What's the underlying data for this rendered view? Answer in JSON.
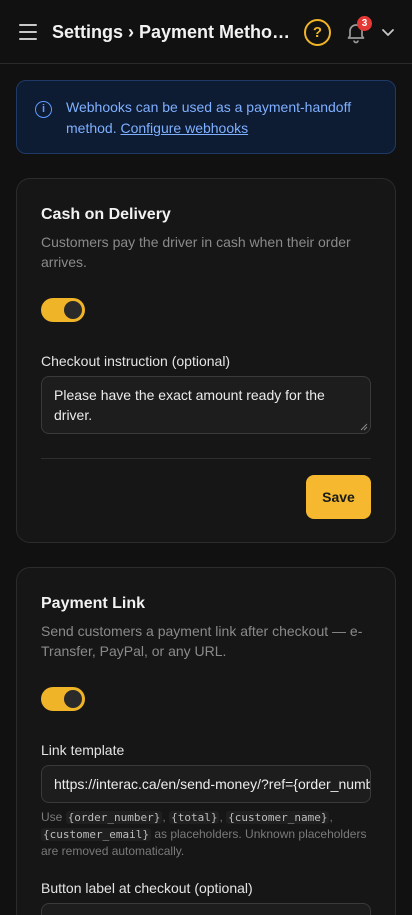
{
  "header": {
    "title": "Settings › Payment Methods",
    "help_glyph": "?",
    "notification_count": "3",
    "icons": [
      "menu-icon",
      "help-icon",
      "bell-icon",
      "chevron-down-icon"
    ]
  },
  "banner": {
    "text": "Webhooks can be used as a payment-handoff method.",
    "link": "Configure webhooks",
    "icon": "info-icon",
    "icon_glyph": "i"
  },
  "cash_on_delivery": {
    "title": "Cash on Delivery",
    "description": "Customers pay the driver in cash when their order arrives.",
    "enabled": true,
    "instruction_label": "Checkout instruction (optional)",
    "instruction_value": "Please have the exact amount ready for the driver.",
    "save_label": "Save"
  },
  "payment_link": {
    "title": "Payment Link",
    "description": "Send customers a payment link after checkout — e-Transfer, PayPal, or any URL.",
    "enabled": true,
    "template_label": "Link template",
    "template_value": "https://interac.ca/en/send-money/?ref={order_number}",
    "help_prefix": "Use",
    "placeholders": [
      "{order_number}",
      "{total}",
      "{customer_name}",
      "{customer_email}"
    ],
    "help_suffix": "as placeholders. Unknown placeholders are removed automatically.",
    "button_label_label": "Button label at checkout (optional)"
  },
  "colors": {
    "accent": "#f5b82e",
    "background": "#111111",
    "card": "#161616",
    "info_text": "#7fb0ff",
    "badge": "#e53935"
  }
}
